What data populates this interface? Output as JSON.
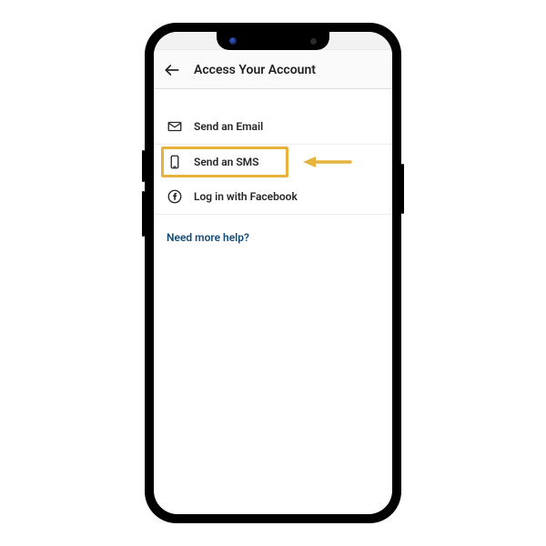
{
  "header": {
    "title": "Access Your Account"
  },
  "options": {
    "email": {
      "label": "Send an Email"
    },
    "sms": {
      "label": "Send an SMS"
    },
    "facebook": {
      "label": "Log in with Facebook"
    }
  },
  "help": {
    "link_text": "Need more help?"
  },
  "annotation": {
    "highlighted_option": "sms"
  }
}
